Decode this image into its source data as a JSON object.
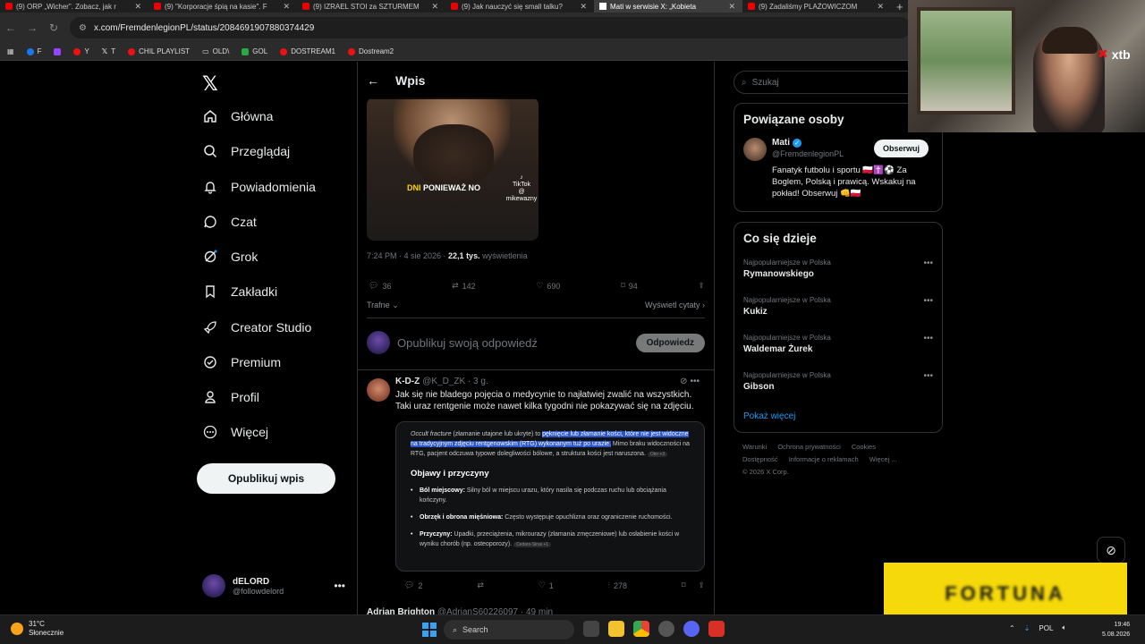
{
  "browser": {
    "tabs": [
      {
        "title": "(9) ORP „Wicher”. Zobacz, jak r",
        "active": false
      },
      {
        "title": "(9) \"Korporacje śpią na kasie\". F",
        "active": false
      },
      {
        "title": "(9) IZRAEL STOI za SZTURMEM",
        "active": false
      },
      {
        "title": "(9) Jak nauczyć się small talku?",
        "active": false
      },
      {
        "title": "Mati w serwisie X: „Kobieta",
        "active": true
      },
      {
        "title": "(9) Zadaliśmy PLAŻOWICZOM",
        "active": false
      }
    ],
    "new_tab": "+",
    "url": "x.com/FremdenlegionPL/status/2084691907880374429",
    "bookmarks": [
      "F",
      "Y",
      "T",
      "CHIL PLAYLIST",
      "OLD\\",
      "GOL",
      "DOSTREAM1",
      "Dostream2"
    ]
  },
  "nav": {
    "items": [
      {
        "label": "Główna",
        "icon": "home-icon"
      },
      {
        "label": "Przeglądaj",
        "icon": "search-icon"
      },
      {
        "label": "Powiadomienia",
        "icon": "bell-icon"
      },
      {
        "label": "Czat",
        "icon": "chat-icon"
      },
      {
        "label": "Grok",
        "icon": "grok-icon"
      },
      {
        "label": "Zakładki",
        "icon": "bookmark-icon"
      },
      {
        "label": "Creator Studio",
        "icon": "rocket-icon"
      },
      {
        "label": "Premium",
        "icon": "premium-icon"
      },
      {
        "label": "Profil",
        "icon": "profile-icon"
      },
      {
        "label": "Więcej",
        "icon": "more-icon"
      }
    ],
    "post_button": "Opublikuj wpis",
    "account": {
      "name": "dELORD",
      "handle": "@followdelord"
    }
  },
  "post": {
    "header": "Wpis",
    "video_caption_yellow": "DNI",
    "video_caption": "PONIEWAŻ NO",
    "video_watermark": "TikTok",
    "video_watermark_handle": "@ mikewazny",
    "time": "7:24 PM · 4 sie 2026 · ",
    "views": "22,1 tys.",
    "views_label": " wyświetlenia",
    "replies": "36",
    "reposts": "142",
    "likes": "690",
    "bookmarks": "94",
    "sort": "Trafne",
    "quotes_link": "Wyświetl cytaty"
  },
  "reply_box": {
    "placeholder": "Opublikuj swoją odpowiedź",
    "button": "Odpowiedz"
  },
  "reply": {
    "name": "K-D-Z",
    "handle": "@K_D_ZK · 3 g.",
    "text": "Jak się nie bladego pojęcia o medycynie to najłatwiej zwalić na wszystkich. Taki uraz rentgenie może nawet kilka tygodni nie pokazywać się na zdjęciu.",
    "card": {
      "intro_term": "Occult fracture",
      "intro_rest": " (złamanie utajone lub ukryte) to ",
      "intro_highlight": "pęknięcie lub złamanie kości, które nie jest widoczne na tradycyjnym zdjęciu rentgenowskim (RTG) wykonanym tuż po urazie.",
      "intro_tail": " Mimo braku widoczności na RTG, pacjent odczuwa typowe dolegliwości bólowe, a struktura kości jest naruszona.",
      "intro_source": "Okn +3",
      "heading": "Objawy i przyczyny",
      "items": [
        {
          "title": "Ból miejscowy:",
          "text": " Silny ból w miejscu urazu, który nasila się podczas ruchu lub obciążania kończyny."
        },
        {
          "title": "Obrzęk i obrona mięśniowa:",
          "text": " Często występuje opuchlizna oraz ograniczenie ruchomości."
        },
        {
          "title": "Przyczyny:",
          "text": " Upadki, przeciążenia, mikrourazy (złamania zmęczeniowe) lub osłabienie kości w wyniku chorób (np. osteoporozy).",
          "source": "Cedars-Sinai +1"
        }
      ]
    },
    "replies": "2",
    "reposts": "",
    "likes": "1",
    "views": "278"
  },
  "next_reply": {
    "name": "Adrian Brighton",
    "handle": "@AdrianS60226097 · 49 min"
  },
  "right": {
    "search_placeholder": "Szukaj",
    "related_title": "Powiązane osoby",
    "person": {
      "name": "Mati",
      "handle": "@FremdenlegionPL",
      "follow": "Obserwuj",
      "bio": "Fanatyk futbolu i sportu 🇵🇱✝️⚽ Za Boglem, Polską i prawicą. Wskakuj na pokład! Obserwuj 👊🇵🇱"
    },
    "trends_title": "Co się dzieje",
    "trends": [
      {
        "category": "Najpopularniejsze w Polska",
        "name": "Rymanowskiego"
      },
      {
        "category": "Najpopularniejsze w Polska",
        "name": "Kukiz"
      },
      {
        "category": "Najpopularniejsze w Polska",
        "name": "Waldemar Żurek"
      },
      {
        "category": "Najpopularniejsze w Polska",
        "name": "Gibson"
      }
    ],
    "show_more": "Pokaż więcej",
    "footer": [
      "Warunki",
      "Ochrona prywatności",
      "Cookies",
      "Dostępność",
      "Informacje o reklamach",
      "Więcej ...",
      "© 2026 X Corp."
    ]
  },
  "overlay": {
    "brand": "xtb",
    "ad_text": "FORTUNA"
  },
  "taskbar": {
    "temp": "31°C",
    "weather": "Słonecznie",
    "search": "Search",
    "lang": "POL",
    "time": "19:46",
    "date": "5.08.2026"
  }
}
